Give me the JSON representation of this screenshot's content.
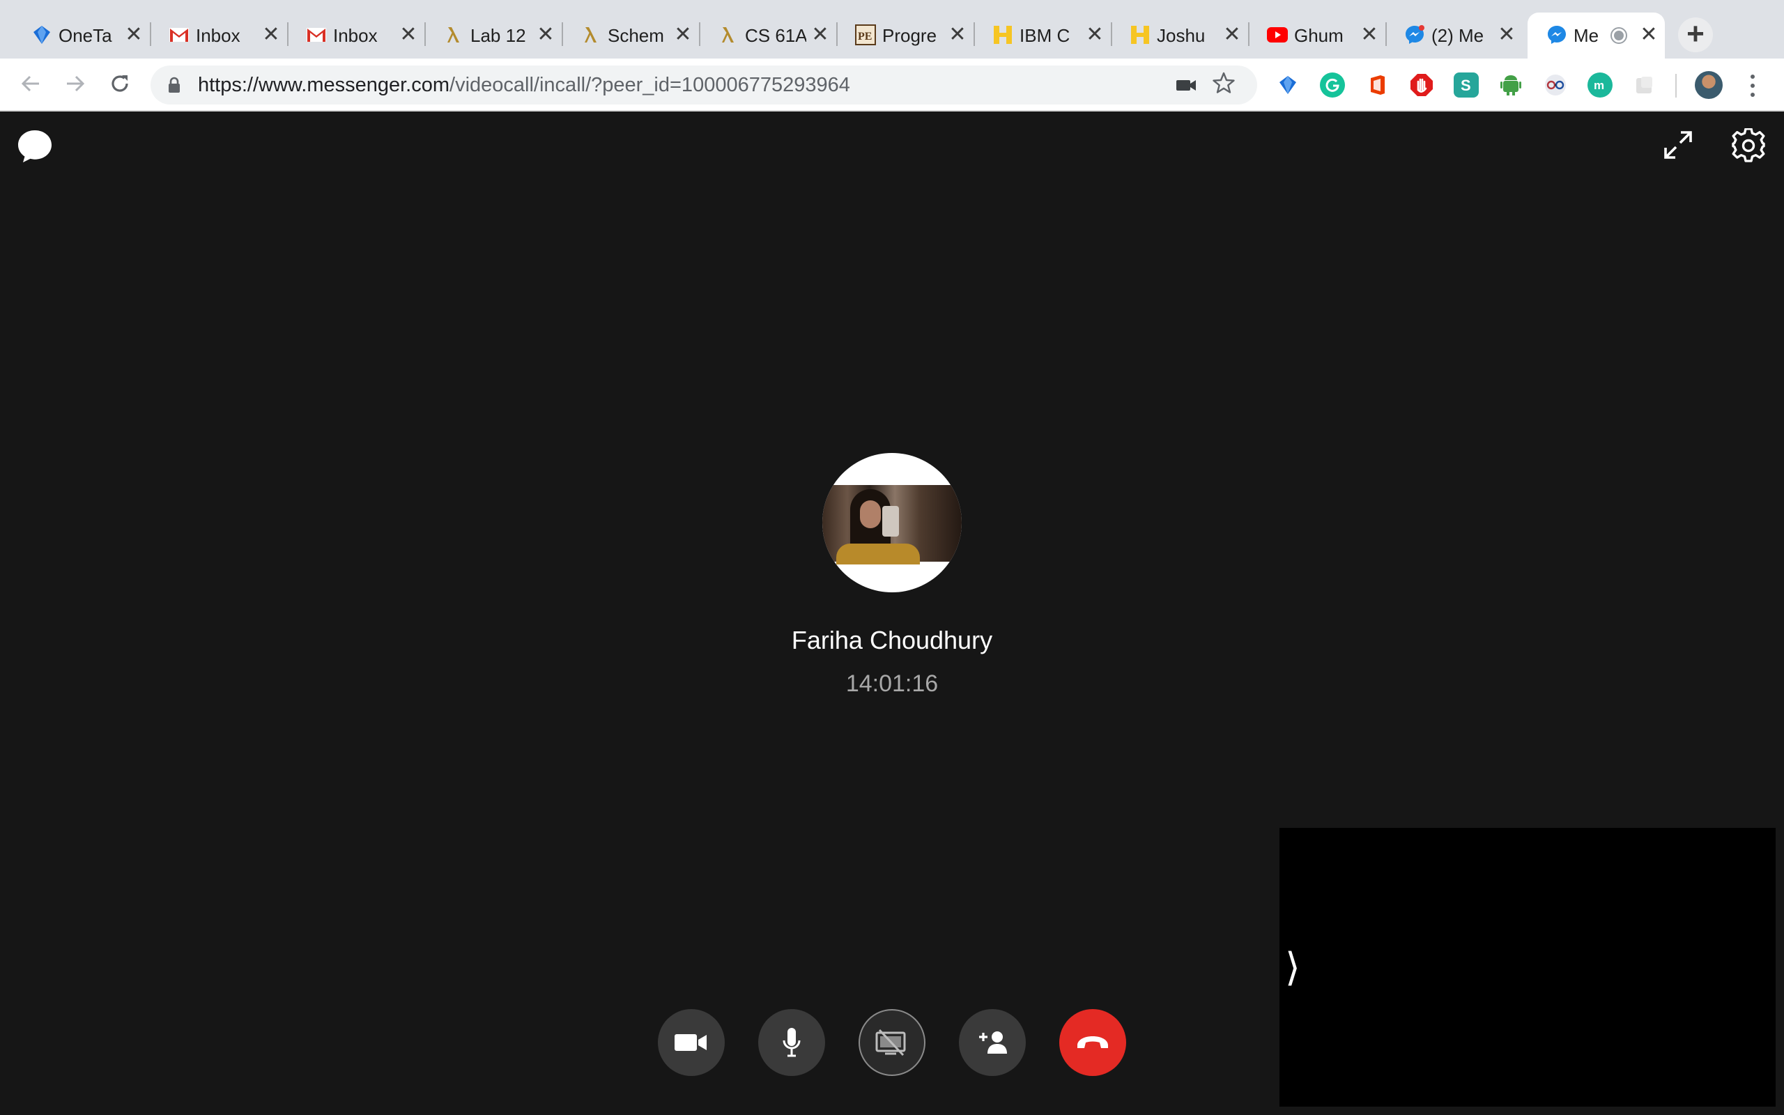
{
  "browser": {
    "tabs": [
      {
        "title": "OneTa",
        "icon": "onetab-icon"
      },
      {
        "title": "Inbox",
        "icon": "gmail-icon"
      },
      {
        "title": "Inbox",
        "icon": "gmail-icon"
      },
      {
        "title": "Lab 12",
        "icon": "lambda-icon"
      },
      {
        "title": "Schem",
        "icon": "lambda-icon"
      },
      {
        "title": "CS 61A",
        "icon": "lambda-icon"
      },
      {
        "title": "Progre",
        "icon": "pe-icon"
      },
      {
        "title": "IBM C",
        "icon": "handshake-icon"
      },
      {
        "title": "Joshu",
        "icon": "handshake-icon"
      },
      {
        "title": "Ghum",
        "icon": "youtube-icon"
      },
      {
        "title": "(2) Me",
        "icon": "messenger-icon"
      },
      {
        "title": "Me",
        "icon": "messenger-icon",
        "active": true
      }
    ],
    "close_glyph": "✕",
    "new_tab_glyph": "+",
    "url_host": "https://www.messenger.com",
    "url_rest": "/videocall/incall/?peer_id=100006775293964",
    "extensions": [
      "onetab",
      "grammarly",
      "office",
      "adblock",
      "s-ext",
      "android-ext",
      "reader-ext",
      "m-ext",
      "placeholder-ext"
    ],
    "colors": {
      "tabstrip": "#dee1e6",
      "toolbar": "#ffffff",
      "omnibox": "#f1f3f4"
    }
  },
  "call": {
    "peer_name": "Fariha Choudhury",
    "timer": "14:01:16",
    "selfview_toggle": "⟩",
    "controls": [
      "camera",
      "microphone",
      "screen-share",
      "add-person",
      "end-call"
    ],
    "colors": {
      "background": "#161616",
      "end_call": "#e42a24",
      "control": "#3a3a3a"
    }
  }
}
